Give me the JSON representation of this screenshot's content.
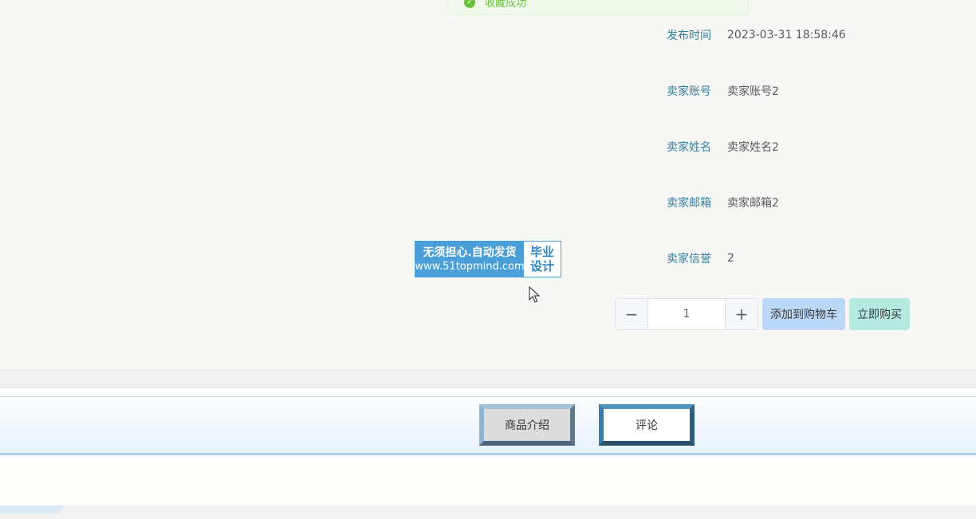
{
  "alert": {
    "message": "收藏成功"
  },
  "details": [
    {
      "label": "发布时间",
      "value": "2023-03-31 18:58:46"
    },
    {
      "label": "卖家账号",
      "value": "卖家账号2"
    },
    {
      "label": "卖家姓名",
      "value": "卖家姓名2"
    },
    {
      "label": "卖家邮箱",
      "value": "卖家邮箱2"
    },
    {
      "label": "卖家信誉",
      "value": "2"
    }
  ],
  "watermark": {
    "line1": "无须担心.自动发货",
    "line2": "www.51topmind.com",
    "right1": "毕业",
    "right2": "设计"
  },
  "quantity": {
    "minus": "−",
    "value": "1",
    "plus": "+"
  },
  "actions": {
    "add_to_cart": "添加到购物车",
    "buy_now": "立即购买"
  },
  "tabs": [
    {
      "label": "商品介绍",
      "active": true
    },
    {
      "label": "评论",
      "active": false
    }
  ],
  "colors": {
    "label": "#2f7fa1",
    "cart": "#bcd8f8",
    "buy": "#b4eadf",
    "tab_border": "#4f93bf"
  }
}
